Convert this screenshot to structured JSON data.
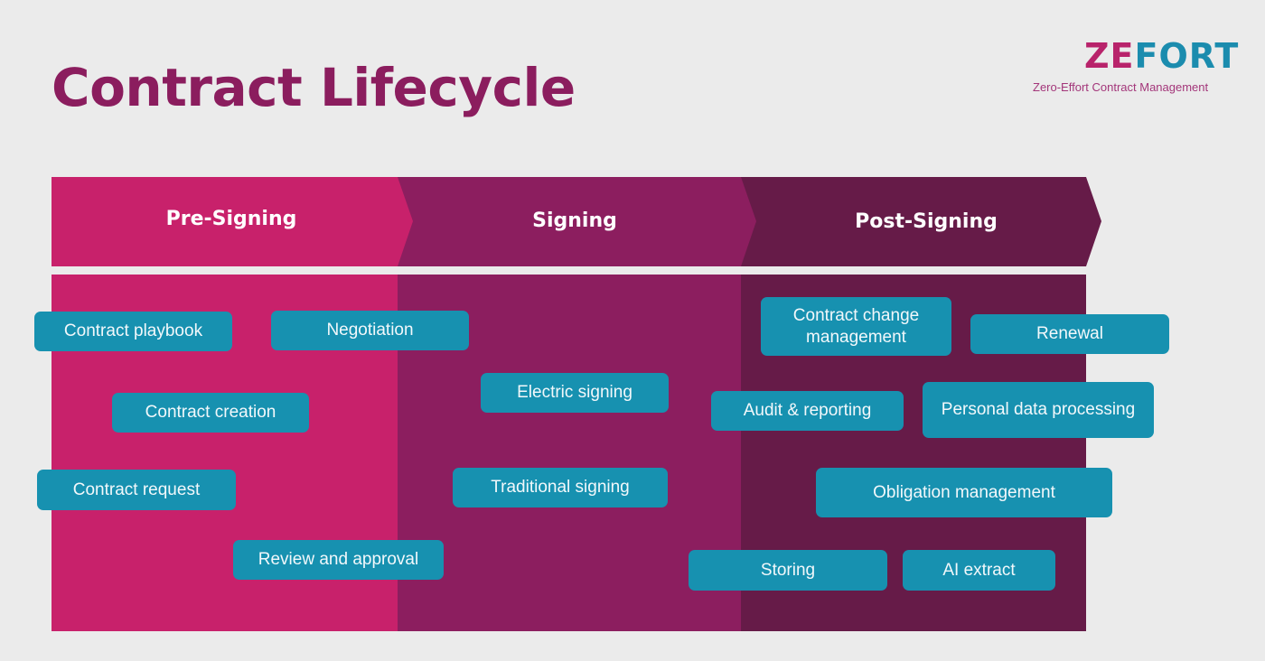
{
  "title": "Contract Lifecycle",
  "logo": {
    "part1": "ZE",
    "part2": "FORT",
    "tagline": "Zero-Effort Contract Management"
  },
  "colors": {
    "pre_signing": "#c8216b",
    "signing": "#8c1e5f",
    "post_signing": "#661b48",
    "chip": "#1791b0",
    "title": "#8b1d5e"
  },
  "phases": [
    {
      "label": "Pre-Signing"
    },
    {
      "label": "Signing"
    },
    {
      "label": "Post-Signing"
    }
  ],
  "activities": {
    "pre_signing": [
      "Contract playbook",
      "Negotiation",
      "Contract creation",
      "Contract request",
      "Review and approval"
    ],
    "signing": [
      "Electric signing",
      "Traditional signing"
    ],
    "post_signing": [
      "Contract change management",
      "Renewal",
      "Audit & reporting",
      "Personal data processing",
      "Obligation management",
      "Storing",
      "AI extract"
    ]
  }
}
